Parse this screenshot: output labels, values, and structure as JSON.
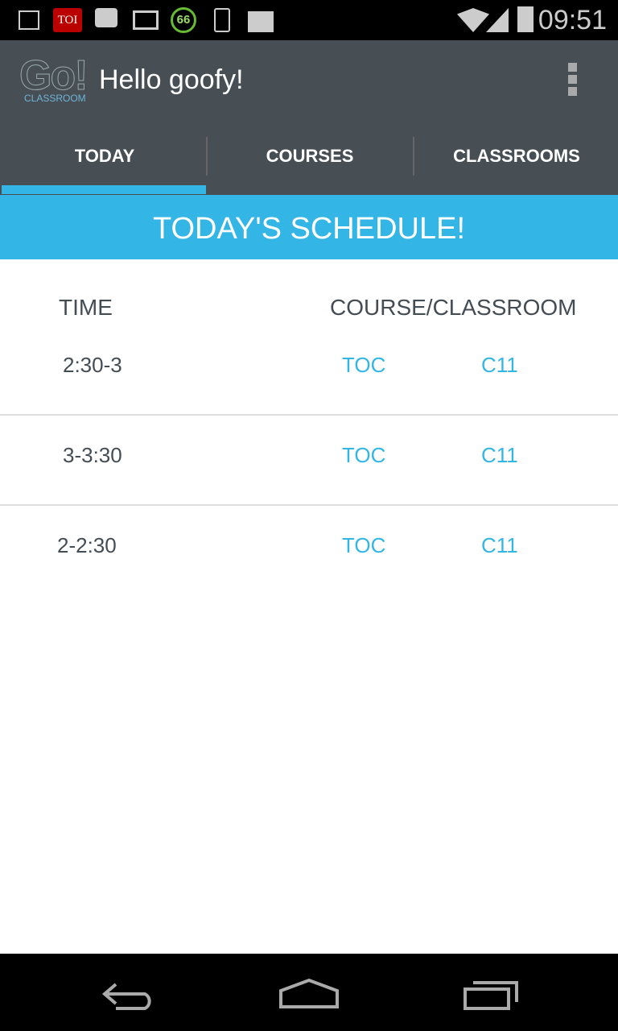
{
  "status_bar": {
    "time": "09:51",
    "icons": [
      "gallery-icon",
      "toi-icon",
      "bbm-icon",
      "gmail-icon",
      "battery-saver-66-icon",
      "phone-icon",
      "play-store-icon",
      "wifi-icon",
      "signal-icon",
      "battery-icon"
    ],
    "toi_label": "TOI",
    "saver_label": "66"
  },
  "app_bar": {
    "logo_text": "Go!",
    "logo_sub": "CLASSROOM",
    "title": "Hello goofy!"
  },
  "tabs": [
    {
      "label": "TODAY",
      "selected": true
    },
    {
      "label": "COURSES"
    },
    {
      "label": "CLASSROOMS"
    }
  ],
  "accent": "#33b5e5",
  "banner": "TODAY'S SCHEDULE!",
  "table": {
    "headers": [
      "TIME",
      "COURSE/CLASSROOM"
    ],
    "rows": [
      {
        "time": "2:30-3",
        "course": "TOC",
        "classroom": "C11"
      },
      {
        "time": "3-3:30",
        "course": "TOC",
        "classroom": "C11"
      },
      {
        "time": "2-2:30",
        "course": "TOC",
        "classroom": "C11"
      }
    ]
  },
  "nav": [
    "back-icon",
    "home-icon",
    "recents-icon"
  ]
}
